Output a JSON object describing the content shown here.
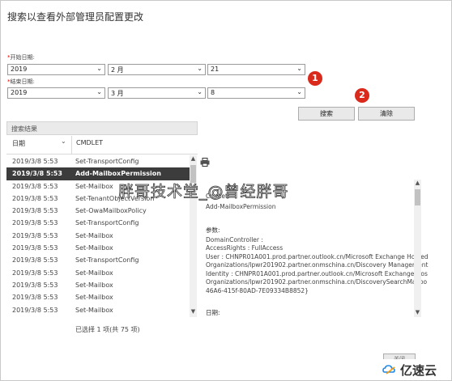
{
  "title": "搜索以查看外部管理员配置更改",
  "start_date": {
    "label_req": "*",
    "label": "开始日期:",
    "year": "2019",
    "month": "2 月",
    "day": "21"
  },
  "end_date": {
    "label_req": "*",
    "label": "结束日期:",
    "year": "2019",
    "month": "3 月",
    "day": "8"
  },
  "badges": {
    "one": "1",
    "two": "2"
  },
  "buttons": {
    "search": "搜索",
    "clear": "清除",
    "bottom": "关闭"
  },
  "results": {
    "header": "搜索结果",
    "columns": {
      "date": "日期",
      "cmdlet": "CMDLET"
    },
    "rows": [
      {
        "date": "2019/3/8 5:53",
        "cmdlet": "Set-TransportConfig"
      },
      {
        "date": "2019/3/8 5:53",
        "cmdlet": "Add-MailboxPermission"
      },
      {
        "date": "2019/3/8 5:53",
        "cmdlet": "Set-Mailbox"
      },
      {
        "date": "2019/3/8 5:53",
        "cmdlet": "Set-TenantObjectVersion"
      },
      {
        "date": "2019/3/8 5:53",
        "cmdlet": "Set-OwaMailboxPolicy"
      },
      {
        "date": "2019/3/8 5:53",
        "cmdlet": "Set-TransportConfig"
      },
      {
        "date": "2019/3/8 5:53",
        "cmdlet": "Set-Mailbox"
      },
      {
        "date": "2019/3/8 5:53",
        "cmdlet": "Set-Mailbox"
      },
      {
        "date": "2019/3/8 5:53",
        "cmdlet": "Set-TransportConfig"
      },
      {
        "date": "2019/3/8 5:53",
        "cmdlet": "Set-Mailbox"
      },
      {
        "date": "2019/3/8 5:53",
        "cmdlet": "Set-Mailbox"
      },
      {
        "date": "2019/3/8 5:53",
        "cmdlet": "Set-Mailbox"
      },
      {
        "date": "2019/3/8 5:53",
        "cmdlet": "Set-Mailbox"
      }
    ],
    "status": "已选择 1 项(共 75 项)"
  },
  "detail": {
    "cmdlet_label": "Cmdlet:",
    "cmdlet_value": "Add-MailboxPermission",
    "params_label": "参数:",
    "lines": [
      "DomainController :",
      "AccessRights : FullAccess",
      "User : CHNPR01A001.prod.partner.outlook.cn/Microsoft Exchange Hosted",
      "Organizations/lpwr201902.partner.onmschina.cn/Discovery Management",
      "Identity : CHNPR01A001.prod.partner.outlook.cn/Microsoft Exchange Hos",
      "Organizations/lpwr201902.partner.onmschina.cn/DiscoverySearchMailbo",
      "46A6-415f-80AD-7E09334B8852}"
    ],
    "date_label": "日期:"
  },
  "watermark": "胖哥技术堂_@曾经胖哥",
  "logo_text": "亿速云",
  "icons": {
    "print": "printer-icon",
    "chevron": "chevron-down-icon"
  },
  "colors": {
    "selected_row": "#3c3c3c",
    "badge": "#d92a1c",
    "button": "#e9e9e9"
  }
}
